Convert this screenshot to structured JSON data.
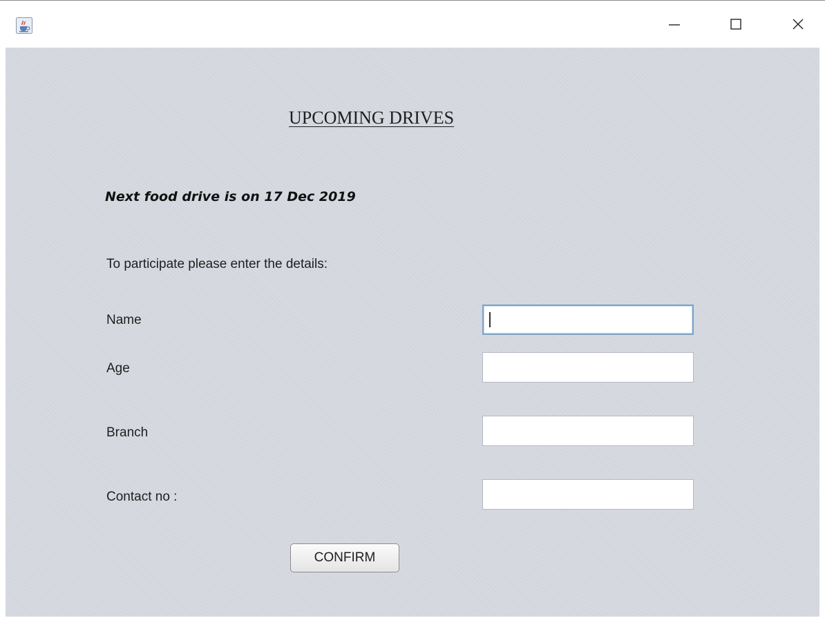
{
  "window": {
    "app_icon": "java-cup-icon",
    "controls": {
      "minimize_icon": "minimize-icon",
      "maximize_icon": "maximize-icon",
      "close_icon": "close-icon"
    }
  },
  "form": {
    "heading": "UPCOMING DRIVES",
    "next_drive": "Next food drive is on 17 Dec 2019",
    "instructions": "To participate please enter the details:",
    "fields": [
      {
        "label": "Name",
        "value": ""
      },
      {
        "label": "Age",
        "value": ""
      },
      {
        "label": "Branch",
        "value": ""
      },
      {
        "label": "Contact no :",
        "value": ""
      }
    ],
    "confirm_label": "CONFIRM"
  },
  "colors": {
    "panel_background": "#d6d9e0",
    "focus_border": "#7ea3c6"
  }
}
